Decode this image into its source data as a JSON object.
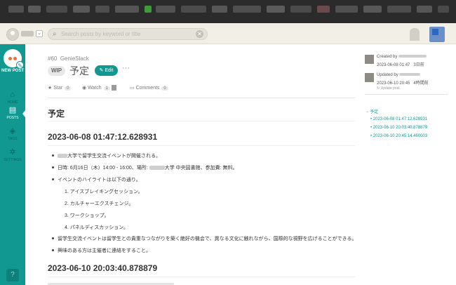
{
  "search": {
    "placeholder": "Search posts by keyword or title"
  },
  "sidebar": {
    "new_post": "NEW POST",
    "items": [
      {
        "label": "HOME",
        "icon": "home-icon"
      },
      {
        "label": "POSTS",
        "icon": "posts-icon"
      },
      {
        "label": "TAGS",
        "icon": "tags-icon"
      },
      {
        "label": "SETTINGS",
        "icon": "gear-icon"
      }
    ],
    "help": "?"
  },
  "post": {
    "number": "#60",
    "category": "GenieSlack",
    "wip": "WIP",
    "title": "予定",
    "edit": "Edit",
    "more": "···",
    "star": "Star",
    "star_count": "0",
    "watch": "Watch",
    "watch_count": "1",
    "comments": "Comments",
    "comments_count": "0"
  },
  "body": {
    "h1": "予定",
    "section1": "2023-06-08 01:47:12.628931",
    "items": [
      "大学で留学生交流イベントが開催される。",
      "日時: 6月16日（木）14:00 - 16:00、場所:",
      "大学 中央図書館、参加費: 無料。",
      "イベントのハイライトは以下の通り。",
      "1. アイスブレイキングセッション。",
      "2. カルチャーエクスチェンジ。",
      "3. ワークショップ。",
      "4. パネルディスカッション。",
      "留学生交流イベントは留学生との貴重なつながりを築く絶好の機会で、異なる文化に触れながら、国際的な視野を広げることができる。",
      "興味のある方は主催者に連絡をすること。"
    ],
    "section2": "2023-06-10 20:03:40.878879"
  },
  "info": {
    "created_label": "Created by",
    "created_date": "2023-06-08 01:47",
    "created_ago": "3日前",
    "updated_label": "Updated by",
    "updated_date": "2023-06-10 20:45",
    "updated_ago": "4時間前",
    "update_note": "Update post."
  },
  "toc": [
    "予定",
    "2023-06-08 01:47:12.628931",
    "2023-06-10 20:03:40.878879",
    "2023-06-10 20:45:14.460003"
  ],
  "colors": {
    "accent": "#109891",
    "topbar": "#f1efe6"
  }
}
